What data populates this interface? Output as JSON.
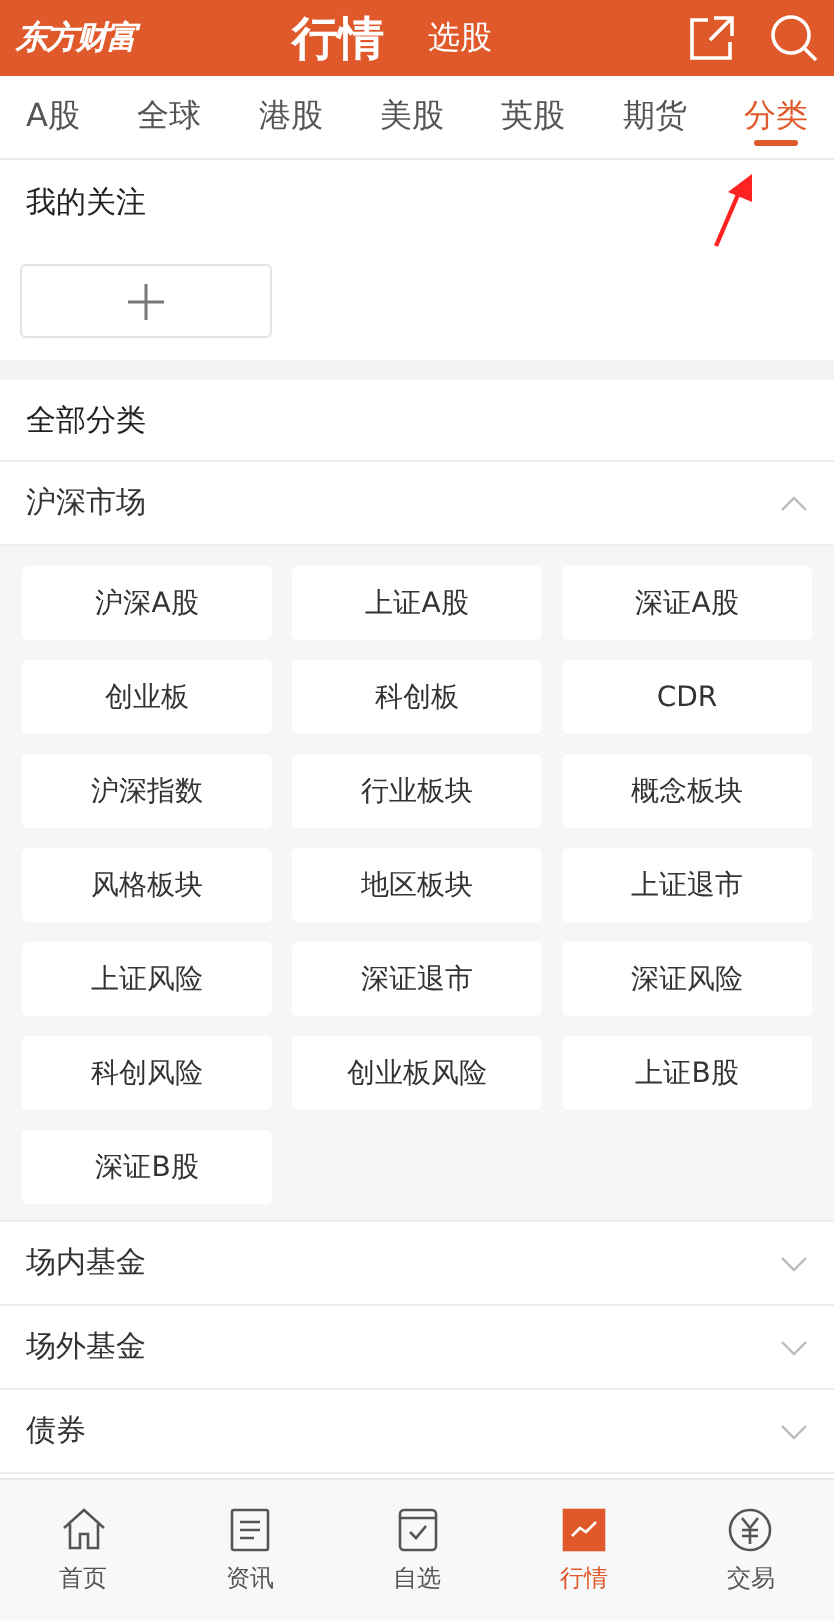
{
  "header": {
    "logo": "东方财富",
    "title": "行情",
    "secondary": "选股"
  },
  "tabs": [
    {
      "label": "A股",
      "selected": false
    },
    {
      "label": "全球",
      "selected": false
    },
    {
      "label": "港股",
      "selected": false
    },
    {
      "label": "美股",
      "selected": false
    },
    {
      "label": "英股",
      "selected": false
    },
    {
      "label": "期货",
      "selected": false
    },
    {
      "label": "分类",
      "selected": true
    }
  ],
  "watchlist": {
    "title": "我的关注"
  },
  "all_categories": {
    "title": "全部分类"
  },
  "groups": [
    {
      "title": "沪深市场",
      "expanded": true,
      "items": [
        "沪深A股",
        "上证A股",
        "深证A股",
        "创业板",
        "科创板",
        "CDR",
        "沪深指数",
        "行业板块",
        "概念板块",
        "风格板块",
        "地区板块",
        "上证退市",
        "上证风险",
        "深证退市",
        "深证风险",
        "科创风险",
        "创业板风险",
        "上证B股",
        "深证B股"
      ]
    },
    {
      "title": "场内基金",
      "expanded": false
    },
    {
      "title": "场外基金",
      "expanded": false
    },
    {
      "title": "债券",
      "expanded": false
    }
  ],
  "bottom_nav": [
    {
      "kind": "home",
      "label": "首页",
      "selected": false
    },
    {
      "kind": "news",
      "label": "资讯",
      "selected": false
    },
    {
      "kind": "watchlist",
      "label": "自选",
      "selected": false
    },
    {
      "kind": "market",
      "label": "行情",
      "selected": true
    },
    {
      "kind": "trade",
      "label": "交易",
      "selected": false
    }
  ]
}
